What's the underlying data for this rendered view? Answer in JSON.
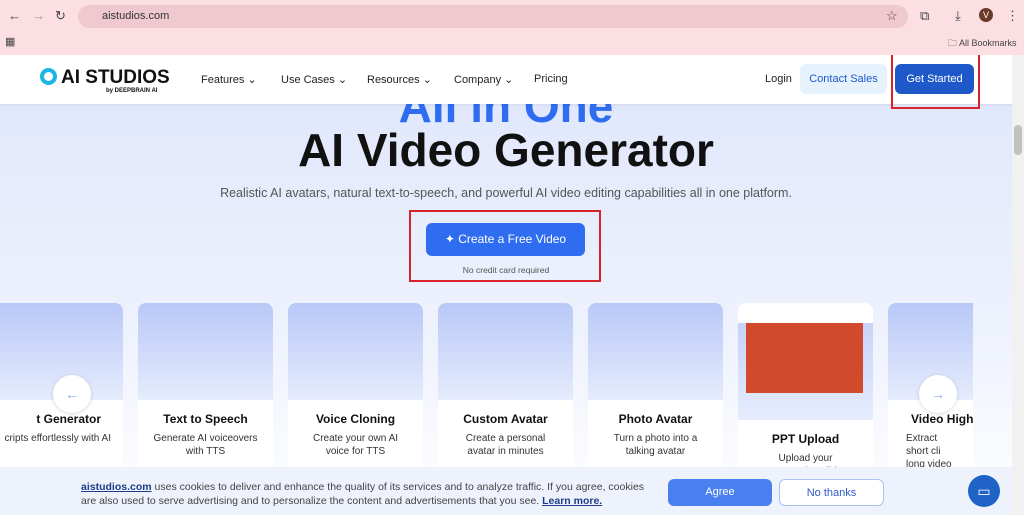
{
  "browser": {
    "url": "aistudios.com",
    "bookmarks_label": "All Bookmarks",
    "profile_initial": "V"
  },
  "header": {
    "logo": "AI STUDIOS",
    "logo_sub": "by DEEPBRAIN AI",
    "nav": [
      "Features",
      "Use Cases",
      "Resources",
      "Company",
      "Pricing"
    ],
    "login": "Login",
    "contact_sales": "Contact Sales",
    "get_started": "Get Started"
  },
  "hero": {
    "eyebrow": "All in One",
    "title": "AI Video Generator",
    "subtitle": "Realistic AI avatars, natural text-to-speech, and powerful AI video editing capabilities all in one platform.",
    "cta": "Create a Free Video",
    "cta_note": "No credit card required"
  },
  "cards": [
    {
      "title": "t Generator",
      "desc": "cripts effortlessly with AI"
    },
    {
      "title": "Text to Speech",
      "desc": "Generate AI voiceovers with TTS"
    },
    {
      "title": "Voice Cloning",
      "desc": "Create your own AI voice for TTS"
    },
    {
      "title": "Custom Avatar",
      "desc": "Create a personal avatar in minutes"
    },
    {
      "title": "Photo Avatar",
      "desc": "Turn a photo into a talking avatar"
    },
    {
      "title": "PPT Upload",
      "desc": "Upload your presentation slides"
    },
    {
      "title": "Video Highli",
      "desc": "Extract short cli long video"
    }
  ],
  "cookie": {
    "link": "aistudios.com",
    "text": " uses cookies to deliver and enhance the quality of its services and to analyze traffic. If you agree, cookies are also used to serve advertising and to personalize the content and advertisements that you see. ",
    "learn_more": "Learn more.",
    "agree": "Agree",
    "no_thanks": "No thanks"
  },
  "colors": {
    "primary": "#1f58c9",
    "cta": "#2f6df0",
    "highlight": "#d8232a"
  }
}
